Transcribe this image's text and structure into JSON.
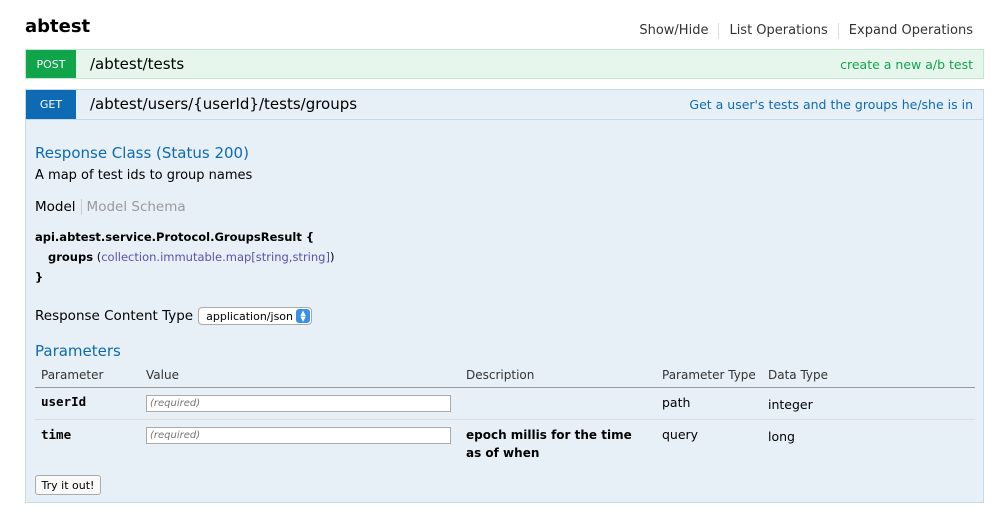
{
  "resource": {
    "title": "abtest",
    "options": [
      "Show/Hide",
      "List Operations",
      "Expand Operations"
    ]
  },
  "operations": {
    "post": {
      "method": "POST",
      "path": "/abtest/tests",
      "summary": "create a new a/b test"
    },
    "get": {
      "method": "GET",
      "path": "/abtest/users/{userId}/tests/groups",
      "summary": "Get a user's tests and the groups he/she is in",
      "response_class_title": "Response Class (Status 200)",
      "response_description": "A map of test ids to group names",
      "model_tabs": {
        "model": "Model",
        "schema": "Model Schema"
      },
      "model": {
        "name": "api.abtest.service.Protocol.GroupsResult {",
        "field_name": "groups",
        "field_type_open": " (",
        "field_type": "collection.immutable.map[string,string]",
        "field_type_close": ")",
        "close": "}"
      },
      "content_type_label": "Response Content Type",
      "content_type_value": "application/json",
      "parameters_title": "Parameters",
      "param_headers": {
        "parameter": "Parameter",
        "value": "Value",
        "description": "Description",
        "parameter_type": "Parameter Type",
        "data_type": "Data Type"
      },
      "params": [
        {
          "name": "userId",
          "placeholder": "(required)",
          "description": "",
          "param_type": "path",
          "data_type": "integer"
        },
        {
          "name": "time",
          "placeholder": "(required)",
          "description": "epoch millis for the time as of when",
          "param_type": "query",
          "data_type": "long"
        }
      ],
      "try_button": "Try it out!"
    }
  },
  "colors": {
    "post_method": "#10a54a",
    "post_background": "#e7f6ec",
    "get_method": "#0f6ab4",
    "get_background": "#e7f0f7"
  },
  "icons": {
    "select_arrow": "chevron-updown-icon"
  }
}
